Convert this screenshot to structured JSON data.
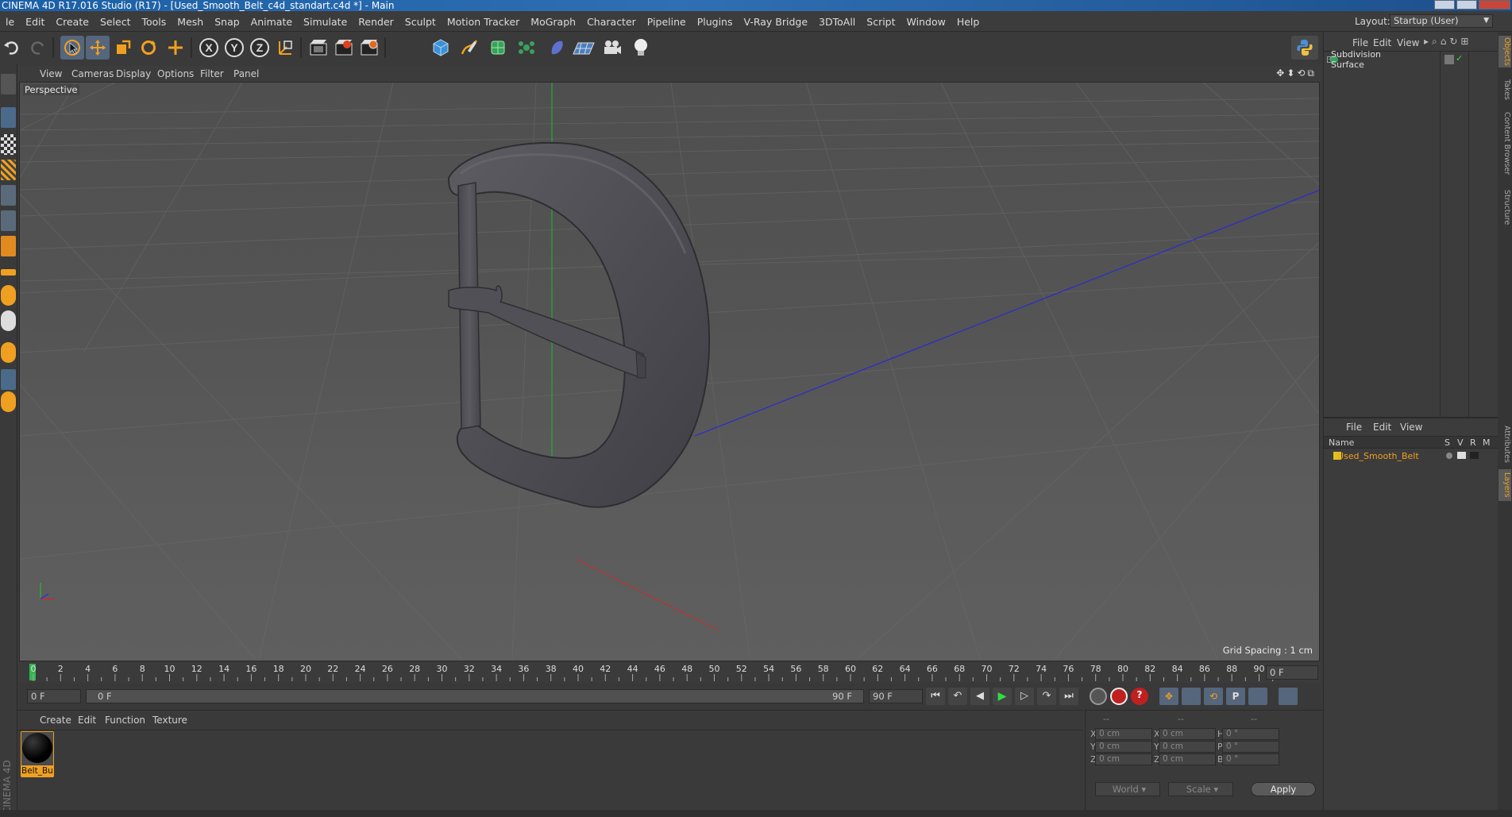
{
  "window": {
    "title": "CINEMA 4D R17.016 Studio (R17) - [Used_Smooth_Belt_c4d_standart.c4d *] - Main"
  },
  "menubar": {
    "items": [
      "le",
      "Edit",
      "Create",
      "Select",
      "Tools",
      "Mesh",
      "Snap",
      "Animate",
      "Simulate",
      "Render",
      "Sculpt",
      "Motion Tracker",
      "MoGraph",
      "Character",
      "Pipeline",
      "Plugins",
      "V-Ray Bridge",
      "3DToAll",
      "Script",
      "Window",
      "Help"
    ],
    "layout_label": "Layout:",
    "layout_value": "Startup (User)"
  },
  "toolbar": {
    "icons": [
      "undo-icon",
      "redo-icon",
      "live-selection-icon",
      "move-icon",
      "scale-icon",
      "rotate-icon",
      "add-icon",
      "x-axis-icon",
      "y-axis-icon",
      "z-axis-icon",
      "world-coordinates-icon",
      "render-view-icon",
      "render-picture-viewer-icon",
      "render-settings-icon",
      "cube-icon",
      "pen-icon",
      "subdivision-icon",
      "mograph-cloner-icon",
      "deformer-icon",
      "floor-icon",
      "camera-icon",
      "light-icon",
      "python-icon"
    ],
    "axis_labels": [
      "X",
      "Y",
      "Z"
    ]
  },
  "viewport": {
    "menu": [
      "View",
      "Cameras",
      "Display",
      "Options",
      "Filter",
      "Panel"
    ],
    "label": "Perspective",
    "grid_spacing": "Grid Spacing : 1 cm"
  },
  "timeline": {
    "ticks": [
      "0",
      "2",
      "4",
      "6",
      "8",
      "10",
      "12",
      "14",
      "16",
      "18",
      "20",
      "22",
      "24",
      "26",
      "28",
      "30",
      "32",
      "34",
      "36",
      "38",
      "40",
      "42",
      "44",
      "46",
      "48",
      "50",
      "52",
      "54",
      "56",
      "58",
      "60",
      "62",
      "64",
      "66",
      "68",
      "70",
      "72",
      "74",
      "76",
      "78",
      "80",
      "82",
      "84",
      "86",
      "88",
      "90"
    ],
    "current_frame": "0 F",
    "start_frame": "0 F",
    "range_start": "0 F",
    "range_end": "90 F",
    "end_frame": "90 F"
  },
  "material_manager": {
    "menu": [
      "Create",
      "Edit",
      "Function",
      "Texture"
    ],
    "materials": [
      {
        "name": "Belt_Bu"
      }
    ],
    "side_label": "CINEMA 4D"
  },
  "coordinates": {
    "header": [
      "--",
      "--",
      "--"
    ],
    "rows": [
      {
        "a": "X",
        "av": "0 cm",
        "b": "X",
        "bv": "0 cm",
        "c": "H",
        "cv": "0 °"
      },
      {
        "a": "Y",
        "av": "0 cm",
        "b": "Y",
        "bv": "0 cm",
        "c": "P",
        "cv": "0 °"
      },
      {
        "a": "Z",
        "av": "0 cm",
        "b": "Z",
        "bv": "0 cm",
        "c": "B",
        "cv": "0 °"
      }
    ],
    "mode1": "World",
    "mode2": "Scale",
    "apply": "Apply"
  },
  "object_manager": {
    "menu": [
      "File",
      "Edit",
      "View"
    ],
    "objects": [
      {
        "name": "Subdivision Surface"
      }
    ]
  },
  "layer_manager": {
    "menu": [
      "File",
      "Edit",
      "View"
    ],
    "columns": [
      "Name",
      "S",
      "V",
      "R",
      "M"
    ],
    "layers": [
      {
        "name": "Used_Smooth_Belt"
      }
    ]
  },
  "right_tabs": [
    "Objects",
    "Takes",
    "Content Browser",
    "Structure",
    "Attributes",
    "Layers"
  ],
  "colors": {
    "accent_orange": "#f0a020",
    "selection_blue": "#55667d",
    "layer_color": "#e0c020"
  }
}
